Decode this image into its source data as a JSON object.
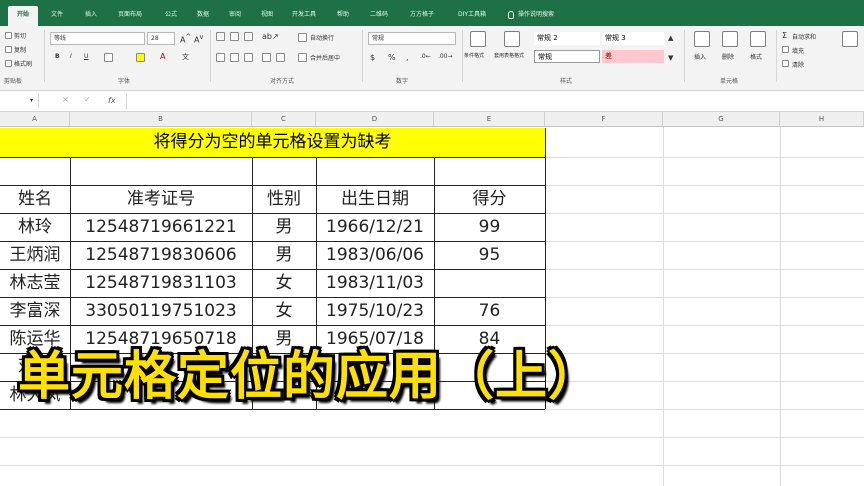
{
  "ribbon": {
    "tabs": [
      "开始",
      "文件",
      "插入",
      "页面布局",
      "公式",
      "数据",
      "审阅",
      "视图",
      "开发工具",
      "帮助",
      "二维码",
      "方方格子",
      "DIY工具箱",
      "操作说明搜索"
    ],
    "clipboard": {
      "cut": "剪切",
      "copy": "复制",
      "format_painter": "格式刷",
      "group": "剪贴板"
    },
    "font": {
      "name": "等线",
      "size": "28",
      "group": "字体"
    },
    "alignment": {
      "wrap": "自动换行",
      "merge": "合并后居中",
      "group": "对齐方式"
    },
    "number": {
      "format": "常规",
      "group": "数字"
    },
    "styles": {
      "cond_format": "条件格式",
      "table_format": "套用表格格式",
      "cell_style_1": "常规 2",
      "cell_style_2": "常规 3",
      "cell_style_3": "常规",
      "cell_style_4": "差",
      "group": "样式"
    },
    "cells": {
      "insert": "插入",
      "delete": "删除",
      "format": "格式",
      "group": "单元格"
    },
    "editing": {
      "autosum": "自动求和",
      "fill": "填充",
      "clear": "清除"
    }
  },
  "formula_bar": {
    "fx": "fx"
  },
  "columns": [
    "A",
    "B",
    "C",
    "D",
    "E",
    "F",
    "G",
    "H"
  ],
  "sheet": {
    "title": "将得分为空的单元格设置为缺考",
    "headers": [
      "姓名",
      "准考证号",
      "性别",
      "出生日期",
      "得分"
    ],
    "rows": [
      [
        "林玲",
        "12548719661221",
        "男",
        "1966/12/21",
        "99"
      ],
      [
        "王炳润",
        "12548719830606",
        "男",
        "1983/06/06",
        "95"
      ],
      [
        "林志莹",
        "12548719831103",
        "女",
        "1983/11/03",
        ""
      ],
      [
        "李富深",
        "33050119751023",
        "女",
        "1975/10/23",
        "76"
      ],
      [
        "陈运华",
        "12548719650718",
        "男",
        "1965/07/18",
        "84"
      ],
      [
        "邓翠",
        "",
        "",
        "",
        ""
      ],
      [
        "林大凤",
        "",
        "",
        "",
        ""
      ]
    ]
  },
  "overlay_caption": "单元格定位的应用（上）",
  "colors": {
    "excel_green": "#1e7145",
    "title_fill": "#ffff00",
    "caption": "#ffe000",
    "bad_style": "#ffc7ce"
  }
}
